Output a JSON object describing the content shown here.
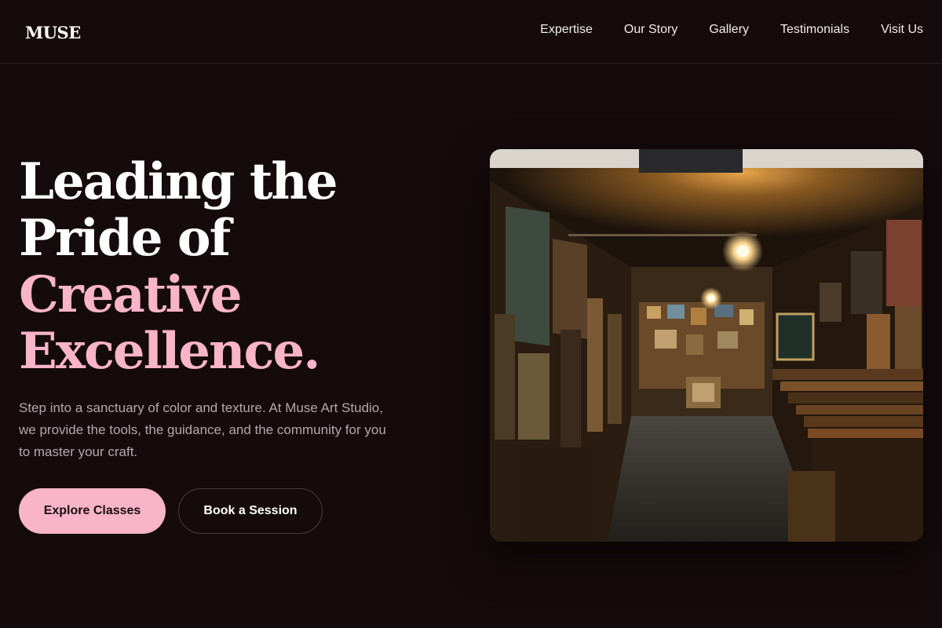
{
  "header": {
    "logo": "MUSE",
    "nav": [
      {
        "label": "Expertise"
      },
      {
        "label": "Our Story"
      },
      {
        "label": "Gallery"
      },
      {
        "label": "Testimonials"
      },
      {
        "label": "Visit Us"
      }
    ]
  },
  "hero": {
    "headline": {
      "line1": "Leading the",
      "line2": "Pride of",
      "line3": "Creative",
      "line4": "Excellence."
    },
    "description": "Step into a sanctuary of color and texture. At Muse Art Studio, we provide the tools, the guidance, and the community for you to master your craft.",
    "primary_button": "Explore Classes",
    "secondary_button": "Book a Session",
    "image_subject": "art-gallery-corridor-photo"
  },
  "colors": {
    "background": "#150a0c",
    "accent": "#f8b4c8",
    "text": "#ffffff",
    "muted_text": "#b3a8ad"
  }
}
